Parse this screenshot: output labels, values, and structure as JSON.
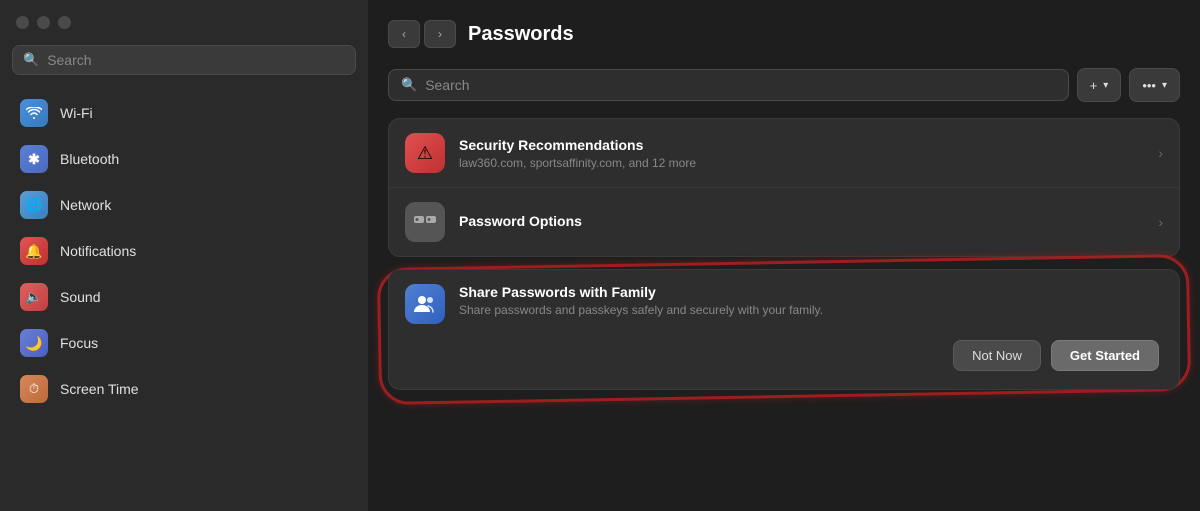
{
  "window": {
    "title": "Passwords"
  },
  "sidebar": {
    "search_placeholder": "Search",
    "items": [
      {
        "id": "wifi",
        "label": "Wi-Fi",
        "icon": "wifi-icon",
        "icon_class": "icon-wifi",
        "symbol": "📶"
      },
      {
        "id": "bluetooth",
        "label": "Bluetooth",
        "icon": "bluetooth-icon",
        "icon_class": "icon-bluetooth",
        "symbol": "✦"
      },
      {
        "id": "network",
        "label": "Network",
        "icon": "network-icon",
        "icon_class": "icon-network",
        "symbol": "🌐"
      },
      {
        "id": "notifications",
        "label": "Notifications",
        "icon": "notifications-icon",
        "icon_class": "icon-notifications",
        "symbol": "🔔"
      },
      {
        "id": "sound",
        "label": "Sound",
        "icon": "sound-icon",
        "icon_class": "icon-sound",
        "symbol": "🔈"
      },
      {
        "id": "focus",
        "label": "Focus",
        "icon": "focus-icon",
        "icon_class": "icon-focus",
        "symbol": "🌙"
      },
      {
        "id": "screentime",
        "label": "Screen Time",
        "icon": "screentime-icon",
        "icon_class": "icon-screentime",
        "symbol": "⏱"
      }
    ]
  },
  "main": {
    "title": "Passwords",
    "search_placeholder": "Search",
    "add_button_label": "+ ˅",
    "more_button_label": "··· ˅",
    "cards": [
      {
        "id": "security",
        "title": "Security Recommendations",
        "subtitle": "law360.com, sportsaffinity.com, and 12 more",
        "icon_class": "icon-security",
        "symbol": "🔒"
      },
      {
        "id": "password-options",
        "title": "Password Options",
        "subtitle": "",
        "icon_class": "icon-password-options",
        "symbol": "⚙"
      }
    ],
    "family_card": {
      "title": "Share Passwords with Family",
      "subtitle": "Share passwords and passkeys safely and securely with your family.",
      "icon_class": "icon-family",
      "symbol": "👥"
    },
    "not_now_label": "Not Now",
    "get_started_label": "Get Started"
  }
}
